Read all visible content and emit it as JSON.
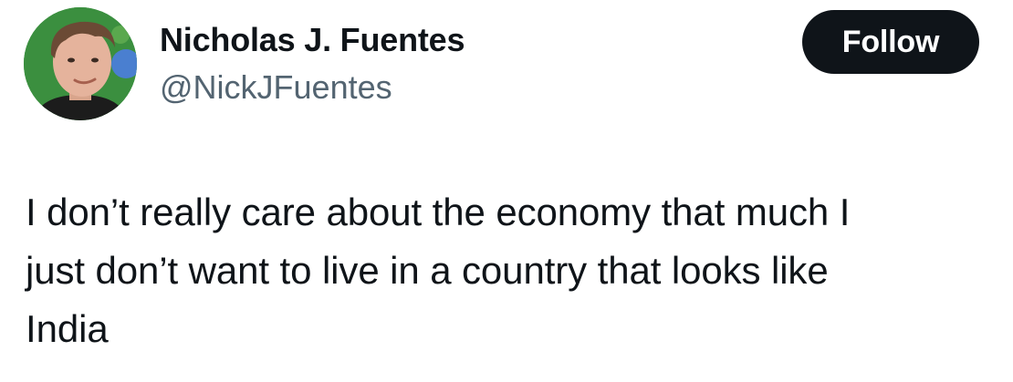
{
  "author": {
    "display_name": "Nicholas J. Fuentes",
    "handle": "@NickJFuentes",
    "avatar_icon": "profile-photo"
  },
  "actions": {
    "follow_label": "Follow"
  },
  "post": {
    "lines": [
      "I don’t really care about the economy that much I",
      "just don’t want to live in a country that looks like",
      "India"
    ]
  },
  "colors": {
    "text_primary": "#0f1419",
    "text_secondary": "#536471",
    "follow_button_bg": "#0f1419",
    "follow_button_text": "#ffffff",
    "background": "#ffffff"
  }
}
